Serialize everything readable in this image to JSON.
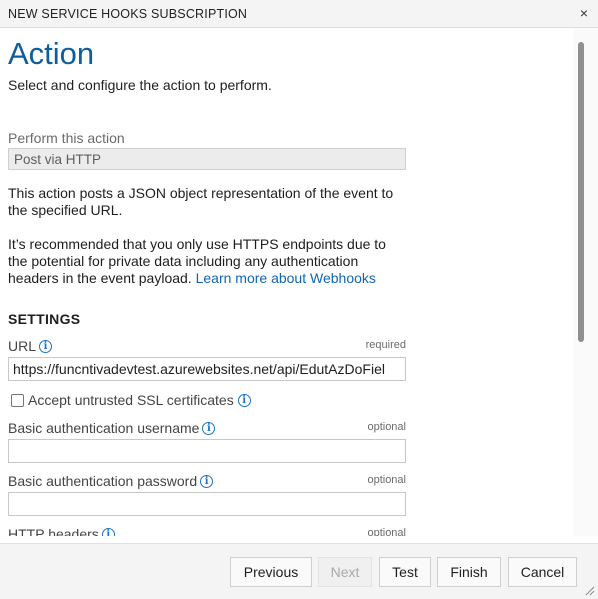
{
  "dialog": {
    "title": "NEW SERVICE HOOKS SUBSCRIPTION",
    "close_glyph": "×"
  },
  "header": {
    "title": "Action",
    "subtitle": "Select and configure the action to perform."
  },
  "action": {
    "label": "Perform this action",
    "value": "Post via HTTP",
    "description": "This action posts a JSON object representation of the event to the specified URL.",
    "recommendation": "It’s recommended that you only use HTTPS endpoints due to the potential for private data including any authentication headers in the event payload.",
    "learn_more_link": "Learn more about Webhooks"
  },
  "settings": {
    "heading": "SETTINGS",
    "url": {
      "label": "URL",
      "tag": "required",
      "value": "https://funcntivadevtest.azurewebsites.net/api/EdutAzDoFiel"
    },
    "ssl": {
      "label": "Accept untrusted SSL certificates",
      "checked": false
    },
    "username": {
      "label": "Basic authentication username",
      "tag": "optional",
      "value": ""
    },
    "password": {
      "label": "Basic authentication password",
      "tag": "optional",
      "value": ""
    },
    "headers": {
      "label": "HTTP headers",
      "tag": "optional"
    }
  },
  "footer": {
    "previous": "Previous",
    "next": "Next",
    "test": "Test",
    "finish": "Finish",
    "cancel": "Cancel"
  },
  "colors": {
    "title_blue": "#0f5d9a",
    "link_blue": "#1365b4",
    "info_blue": "#1a73c7"
  }
}
